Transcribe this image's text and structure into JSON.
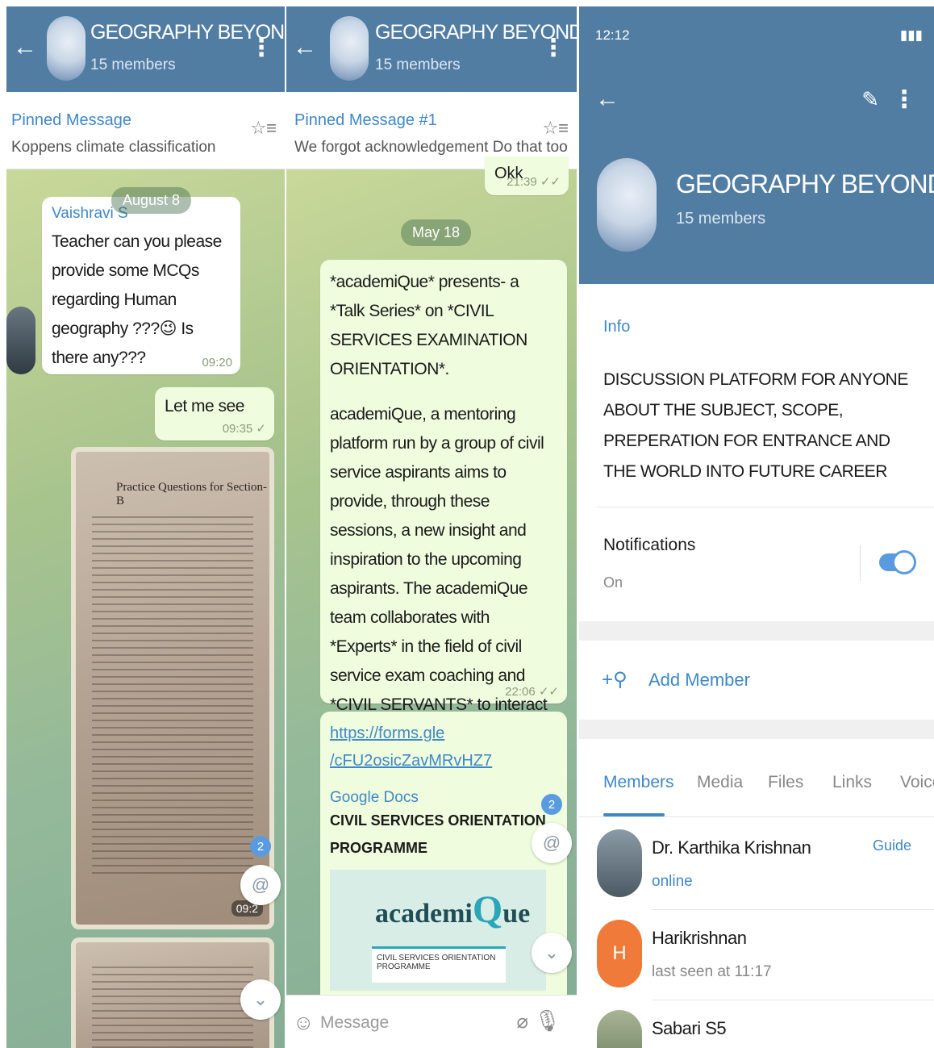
{
  "panel1": {
    "header": {
      "title": "GEOGRAPHY BEYOND...",
      "members": "15 members"
    },
    "pinned": {
      "label": "Pinned Message",
      "text": "Koppens climate classification"
    },
    "date_pill": "August 8",
    "message1": {
      "sender": "Vaishravi S",
      "text": "Teacher can you please provide some MCQs regarding Human geography ???😉 Is there any???",
      "time": "09:20"
    },
    "message2": {
      "text": "Let me see",
      "time": "09:35 ✓"
    },
    "photo": {
      "heading": "Practice Questions for Section-B",
      "time": "09:2"
    },
    "badge": "2",
    "fab_mention": "@",
    "fab_down": "⌄"
  },
  "panel2": {
    "header": {
      "title": "GEOGRAPHY BEYOND...",
      "members": "15 members"
    },
    "pinned": {
      "label": "Pinned Message #1",
      "text": "We forgot acknowledgement  Do that too"
    },
    "top_reply": {
      "text": "Okk",
      "time": "21:39 ✓✓"
    },
    "date_pill": "May 18",
    "message": {
      "para1": "*academiQue* presents- a *Talk Series* on *CIVIL SERVICES EXAMINATION ORIENTATION*.",
      "para2": "academiQue, a mentoring platform run by a group of civil service aspirants aims to provide, through these sessions, a new insight and inspiration to the upcoming aspirants. The academiQue team collaborates with *Experts* in the field of civil service exam coaching and *CIVIL SERVANTS* to interact with students and to guide them in attaining their dream career.",
      "time": "22:06 ✓✓"
    },
    "link_message": {
      "url": "https://forms.gle /cFU2osicZavMRvHZ7",
      "source": "Google Docs",
      "title": "CIVIL SERVICES ORIENTATION PROGRAMME",
      "logo_a": "academi",
      "logo_q": "Q",
      "logo_b": "ue",
      "strip_text": "CIVIL SERVICES ORIENTATION PROGRAMME"
    },
    "badge": "2",
    "fab_mention": "@",
    "fab_down": "⌄",
    "input_placeholder": "Message"
  },
  "panel3": {
    "status": {
      "time": "12:12",
      "right": "▮▮▮"
    },
    "header": {
      "title": "GEOGRAPHY BEYOND THE I",
      "members": "15 members"
    },
    "info_label": "Info",
    "info_text": "DISCUSSION PLATFORM FOR ANYONE ABOUT THE SUBJECT, SCOPE, PREPERATION FOR ENTRANCE AND THE WORLD INTO FUTURE CAREER",
    "notifications": {
      "label": "Notifications",
      "value": "On",
      "enabled": true
    },
    "add_member": "Add Member",
    "tabs": [
      "Members",
      "Media",
      "Files",
      "Links",
      "Voice"
    ],
    "members": [
      {
        "name": "Dr. Karthika Krishnan",
        "status": "online",
        "role": "Guide",
        "avatar_color": "#6d7f8c"
      },
      {
        "name": "Harikrishnan",
        "status": "last seen at 11:17",
        "role": "",
        "avatar_initial": "H",
        "avatar_color": "#f07a3a"
      },
      {
        "name": "Sabari S5",
        "status": "",
        "role": "",
        "avatar_color": "#8b9c7e"
      }
    ]
  }
}
